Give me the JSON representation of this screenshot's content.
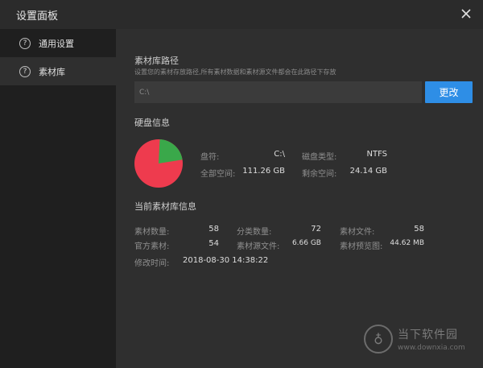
{
  "window": {
    "title": "设置面板",
    "close_icon": "close-icon"
  },
  "sidebar": {
    "items": [
      {
        "label": "通用设置",
        "icon": "help-circle-icon",
        "icon_glyph": "?"
      },
      {
        "label": "素材库",
        "icon": "help-circle-icon",
        "icon_glyph": "?"
      }
    ],
    "active": "素材库"
  },
  "library_path": {
    "heading": "素材库路径",
    "description": "设置您的素材存放路径,所有素材数据和素材源文件都会在此路径下存放",
    "value": "C:\\",
    "change_label": "更改"
  },
  "disk": {
    "heading": "硬盘信息",
    "drive_label": "盘符:",
    "drive_value": "C:\\",
    "fs_label": "磁盘类型:",
    "fs_value": "NTFS",
    "total_label": "全部空间:",
    "total_value": "111.26 GB",
    "free_label": "剩余空间:",
    "free_value": "24.14 GB",
    "pie": {
      "used_fraction": 0.783,
      "free_fraction": 0.217,
      "used_color": "#ee3b4e",
      "free_color": "#3aa84a"
    }
  },
  "library_info": {
    "heading": "当前素材库信息",
    "count_label": "素材数量:",
    "count_value": "58",
    "category_label": "分类数量:",
    "category_value": "72",
    "files_label": "素材文件:",
    "files_value": "58",
    "official_label": "官方素材:",
    "official_value": "54",
    "source_label": "素材源文件:",
    "source_value": "6.66 GB",
    "preview_label": "素材预览图:",
    "preview_value": "44.62 MB",
    "modified_label": "修改时间:",
    "modified_value": "2018-08-30 14:38:22"
  },
  "watermark": {
    "text": "当下软件园",
    "url": "www.downxia.com"
  }
}
